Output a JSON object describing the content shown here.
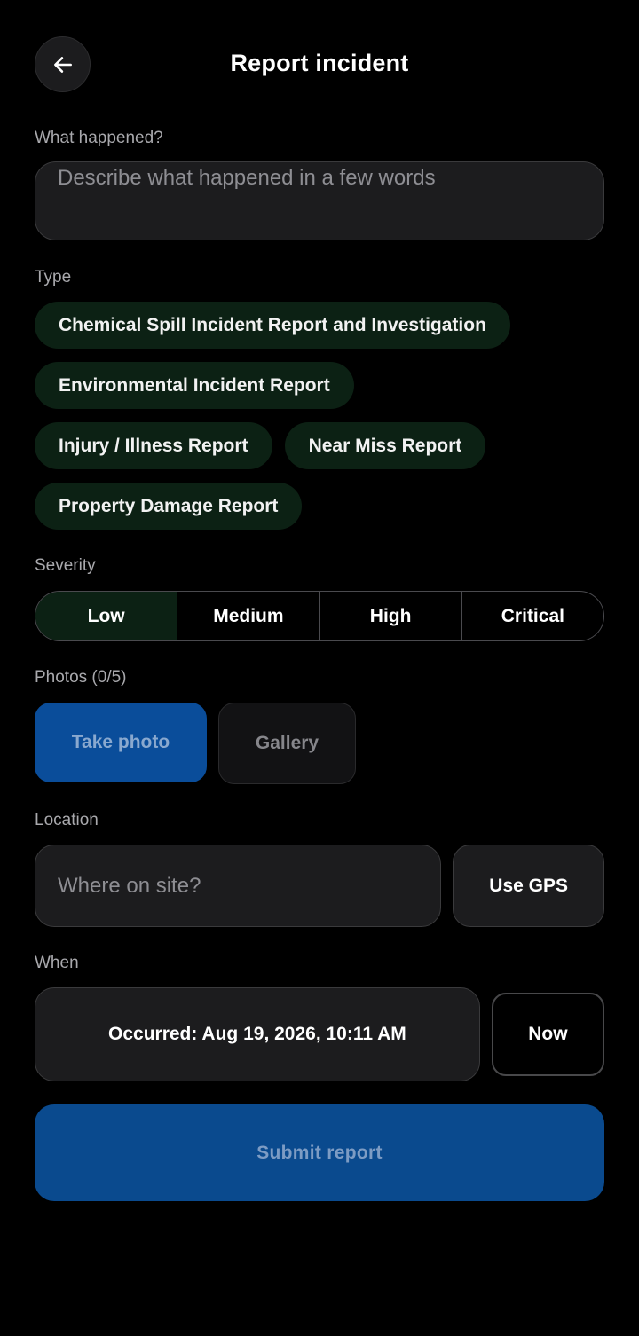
{
  "header": {
    "title": "Report incident",
    "back_icon": "arrow-left-icon"
  },
  "what": {
    "label": "What happened?",
    "placeholder": "Describe what happened in a few words"
  },
  "type": {
    "label": "Type",
    "options": [
      "Chemical Spill Incident Report and Investigation",
      "Environmental Incident Report",
      "Injury / Illness Report",
      "Near Miss Report",
      "Property Damage Report"
    ]
  },
  "severity": {
    "label": "Severity",
    "options": [
      "Low",
      "Medium",
      "High",
      "Critical"
    ],
    "selected": "Low"
  },
  "photos": {
    "label": "Photos (0/5)",
    "take_label": "Take photo",
    "gallery_label": "Gallery"
  },
  "location": {
    "label": "Location",
    "placeholder": "Where on site?",
    "gps_label": "Use GPS"
  },
  "when": {
    "label": "When",
    "value": "Occurred: Aug 19, 2026, 10:11 AM",
    "now_label": "Now"
  },
  "submit": {
    "label": "Submit report"
  },
  "colors": {
    "background": "#000000",
    "chip_bg": "#0c2114",
    "primary_blue": "#0a4d9a",
    "field_bg": "#1c1c1e"
  }
}
